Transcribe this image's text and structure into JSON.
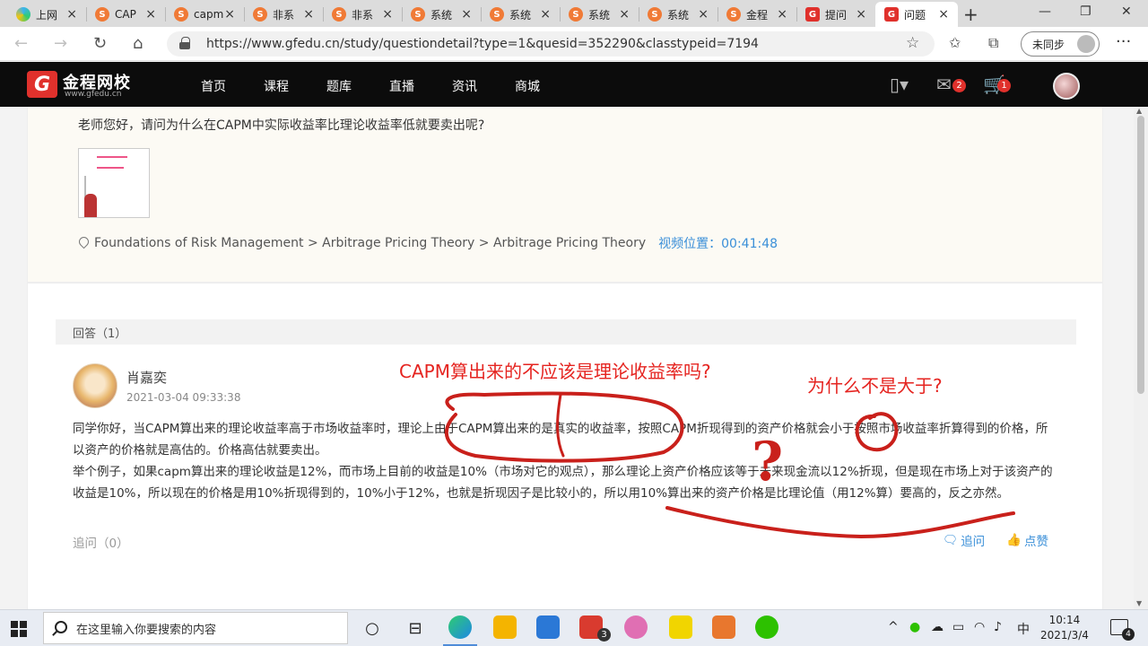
{
  "browser": {
    "tabs": [
      {
        "label": "上网",
        "icon": "edge-icon"
      },
      {
        "label": "CAP",
        "icon": "s-site-icon"
      },
      {
        "label": "capm",
        "icon": "s-site-icon"
      },
      {
        "label": "非系",
        "icon": "s-site-icon"
      },
      {
        "label": "非系",
        "icon": "s-site-icon"
      },
      {
        "label": "系统",
        "icon": "s-site-icon"
      },
      {
        "label": "系统",
        "icon": "s-site-icon"
      },
      {
        "label": "系统",
        "icon": "s-site-icon"
      },
      {
        "label": "系统",
        "icon": "s-site-icon"
      },
      {
        "label": "金程",
        "icon": "s-site-icon"
      },
      {
        "label": "提问",
        "icon": "gfedu-icon"
      },
      {
        "label": "问题",
        "icon": "gfedu-icon"
      }
    ],
    "tab_close_glyph": "×",
    "new_tab_glyph": "+",
    "window_controls": {
      "minimize": "—",
      "maximize": "❐",
      "close": "✕"
    },
    "nav": {
      "back": "←",
      "forward": "→",
      "refresh": "↻",
      "home": "⌂"
    },
    "url": "https://www.gfedu.cn/study/questiondetail?type=1&quesid=352290&classtypeid=7194",
    "sync_label": "未同步",
    "more_glyph": "···"
  },
  "site": {
    "logo_mark": "G",
    "logo_name": "金程网校",
    "logo_domain": "www.gfedu.cn",
    "nav": [
      "首页",
      "课程",
      "题库",
      "直播",
      "资讯",
      "商城"
    ],
    "mail_badge": "2",
    "cart_badge": "1",
    "colors": {
      "brand": "#e0312c",
      "header_bg": "#0c0c0c",
      "link": "#3a8fd8"
    }
  },
  "question": {
    "text": "老师您好，请问为什么在CAPM中实际收益率比理论收益率低就要卖出呢?",
    "breadcrumb": "Foundations of Risk Management > Arbitrage Pricing Theory > Arbitrage Pricing Theory",
    "video_position_label": "视频位置：",
    "video_position": "00:41:48"
  },
  "answers": {
    "header": "回答（1）",
    "items": [
      {
        "author": "肖嘉奕",
        "time": "2021-03-04 09:33:38",
        "paragraphs": [
          "同学你好，当CAPM算出来的理论收益率高于市场收益率时，理论上由于CAPM算出来的是真实的收益率，按照CAPM折现得到的资产价格就会小于按照市场收益率折算得到的价格，所以资产的价格就是高估的。价格高估就要卖出。",
          "举个例子，如果capm算出来的理论收益是12%，而市场上目前的收益是10%（市场对它的观点），那么理论上资产价格应该等于未来现金流以12%折现，但是现在市场上对于该资产的收益是10%，所以现在的价格是用10%折现得到的，10%小于12%，也就是折现因子是比较小的，所以用10%算出来的资产价格是比理论值（用12%算）要高的，反之亦然。"
        ],
        "followup": "追问（0）",
        "action_followup": "追问",
        "action_like": "点赞"
      }
    ]
  },
  "annotations": {
    "note1": "CAPM算出来的不应该是理论收益率吗?",
    "note2": "为什么不是大于?",
    "note3": "?",
    "ink_color": "#c9201b"
  },
  "taskbar": {
    "search_placeholder": "在这里输入你要搜索的内容",
    "app_badge": "3",
    "ime": "中",
    "time": "10:14",
    "date": "2021/3/4",
    "notification_count": "4"
  }
}
